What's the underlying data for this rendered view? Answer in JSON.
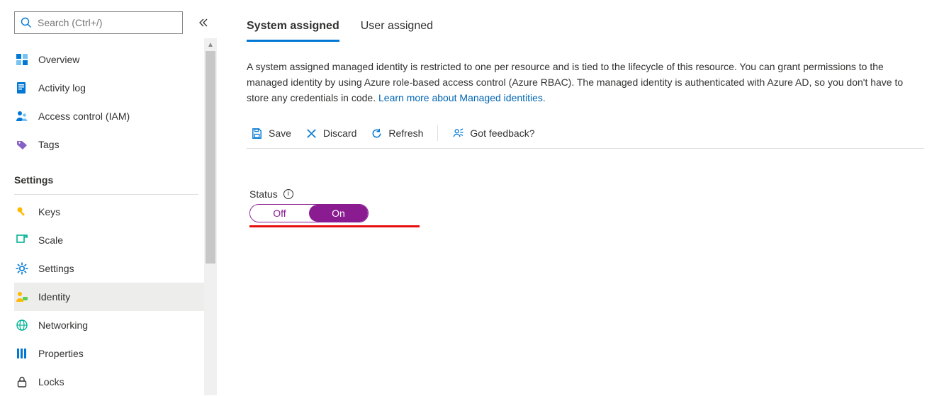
{
  "sidebar": {
    "search_placeholder": "Search (Ctrl+/)",
    "items": [
      {
        "label": "Overview"
      },
      {
        "label": "Activity log"
      },
      {
        "label": "Access control (IAM)"
      },
      {
        "label": "Tags"
      }
    ],
    "settings_header": "Settings",
    "settings_items": [
      {
        "label": "Keys"
      },
      {
        "label": "Scale"
      },
      {
        "label": "Settings"
      },
      {
        "label": "Identity"
      },
      {
        "label": "Networking"
      },
      {
        "label": "Properties"
      },
      {
        "label": "Locks"
      }
    ]
  },
  "tabs": {
    "system": "System assigned",
    "user": "User assigned"
  },
  "intro_text": "A system assigned managed identity is restricted to one per resource and is tied to the lifecycle of this resource. You can grant permissions to the managed identity by using Azure role-based access control (Azure RBAC). The managed identity is authenticated with Azure AD, so you don't have to store any credentials in code. ",
  "intro_link": "Learn more about Managed identities.",
  "cmdbar": {
    "save": "Save",
    "discard": "Discard",
    "refresh": "Refresh",
    "feedback": "Got feedback?"
  },
  "status": {
    "label": "Status",
    "off": "Off",
    "on": "On",
    "value": "On"
  },
  "colors": {
    "link": "#0066b4",
    "accent_tab": "#0078d4",
    "toggle": "#8a1b91",
    "annotation": "#e80d0d"
  }
}
